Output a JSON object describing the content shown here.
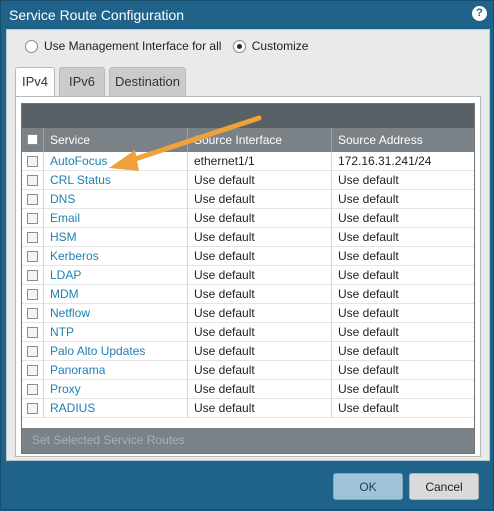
{
  "window": {
    "title": "Service Route Configuration"
  },
  "options": {
    "radio1_label": "Use Management Interface for all",
    "radio2_label": "Customize",
    "selected": "Customize"
  },
  "tabs": [
    {
      "label": "IPv4",
      "active": true
    },
    {
      "label": "IPv6",
      "active": false
    },
    {
      "label": "Destination",
      "active": false
    }
  ],
  "table": {
    "columns": [
      "Service",
      "Source Interface",
      "Source Address"
    ],
    "rows": [
      {
        "service": "AutoFocus",
        "source_interface": "ethernet1/1",
        "source_address": "172.16.31.241/24"
      },
      {
        "service": "CRL Status",
        "source_interface": "Use default",
        "source_address": "Use default"
      },
      {
        "service": "DNS",
        "source_interface": "Use default",
        "source_address": "Use default"
      },
      {
        "service": "Email",
        "source_interface": "Use default",
        "source_address": "Use default"
      },
      {
        "service": "HSM",
        "source_interface": "Use default",
        "source_address": "Use default"
      },
      {
        "service": "Kerberos",
        "source_interface": "Use default",
        "source_address": "Use default"
      },
      {
        "service": "LDAP",
        "source_interface": "Use default",
        "source_address": "Use default"
      },
      {
        "service": "MDM",
        "source_interface": "Use default",
        "source_address": "Use default"
      },
      {
        "service": "Netflow",
        "source_interface": "Use default",
        "source_address": "Use default"
      },
      {
        "service": "NTP",
        "source_interface": "Use default",
        "source_address": "Use default"
      },
      {
        "service": "Palo Alto Updates",
        "source_interface": "Use default",
        "source_address": "Use default"
      },
      {
        "service": "Panorama",
        "source_interface": "Use default",
        "source_address": "Use default"
      },
      {
        "service": "Proxy",
        "source_interface": "Use default",
        "source_address": "Use default"
      },
      {
        "service": "RADIUS",
        "source_interface": "Use default",
        "source_address": "Use default"
      }
    ],
    "footer_action": "Set Selected Service Routes"
  },
  "buttons": {
    "ok": "OK",
    "cancel": "Cancel"
  },
  "colors": {
    "title_bar": "#20638a",
    "link": "#1e7fb4",
    "annotation_arrow": "#f0a23a"
  }
}
